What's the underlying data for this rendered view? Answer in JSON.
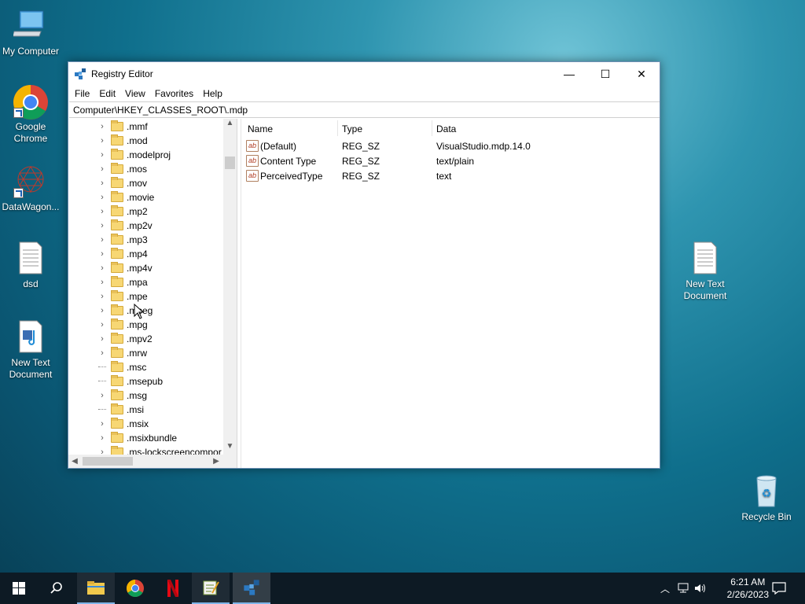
{
  "desktop": {
    "icons": [
      {
        "label": "My Computer"
      },
      {
        "label": "Google Chrome"
      },
      {
        "label": "DataWagon..."
      },
      {
        "label": "dsd"
      },
      {
        "label": "New Text Document"
      },
      {
        "label": "New Text Document"
      },
      {
        "label": "Recycle Bin"
      }
    ]
  },
  "window": {
    "title": "Registry Editor",
    "controls": {
      "minimize": "—",
      "maximize": "☐",
      "close": "✕"
    },
    "menu": [
      "File",
      "Edit",
      "View",
      "Favorites",
      "Help"
    ],
    "address": "Computer\\HKEY_CLASSES_ROOT\\.mdp",
    "tree": [
      {
        "label": ".mmf",
        "expandable": true
      },
      {
        "label": ".mod",
        "expandable": true
      },
      {
        "label": ".modelproj",
        "expandable": true
      },
      {
        "label": ".mos",
        "expandable": true
      },
      {
        "label": ".mov",
        "expandable": true
      },
      {
        "label": ".movie",
        "expandable": true
      },
      {
        "label": ".mp2",
        "expandable": true
      },
      {
        "label": ".mp2v",
        "expandable": true
      },
      {
        "label": ".mp3",
        "expandable": true
      },
      {
        "label": ".mp4",
        "expandable": true
      },
      {
        "label": ".mp4v",
        "expandable": true
      },
      {
        "label": ".mpa",
        "expandable": true
      },
      {
        "label": ".mpe",
        "expandable": true
      },
      {
        "label": ".mpeg",
        "expandable": true
      },
      {
        "label": ".mpg",
        "expandable": true
      },
      {
        "label": ".mpv2",
        "expandable": true
      },
      {
        "label": ".mrw",
        "expandable": true
      },
      {
        "label": ".msc",
        "expandable": false
      },
      {
        "label": ".msepub",
        "expandable": false
      },
      {
        "label": ".msg",
        "expandable": true
      },
      {
        "label": ".msi",
        "expandable": false
      },
      {
        "label": ".msix",
        "expandable": true
      },
      {
        "label": ".msixbundle",
        "expandable": true
      },
      {
        "label": ".ms-lockscreencompor",
        "expandable": true
      }
    ],
    "columns": {
      "name": "Name",
      "type": "Type",
      "data": "Data"
    },
    "values": [
      {
        "name": "(Default)",
        "type": "REG_SZ",
        "data": "VisualStudio.mdp.14.0"
      },
      {
        "name": "Content Type",
        "type": "REG_SZ",
        "data": "text/plain"
      },
      {
        "name": "PerceivedType",
        "type": "REG_SZ",
        "data": "text"
      }
    ]
  },
  "taskbar": {
    "time": "6:21 AM",
    "date": "2/26/2023"
  }
}
